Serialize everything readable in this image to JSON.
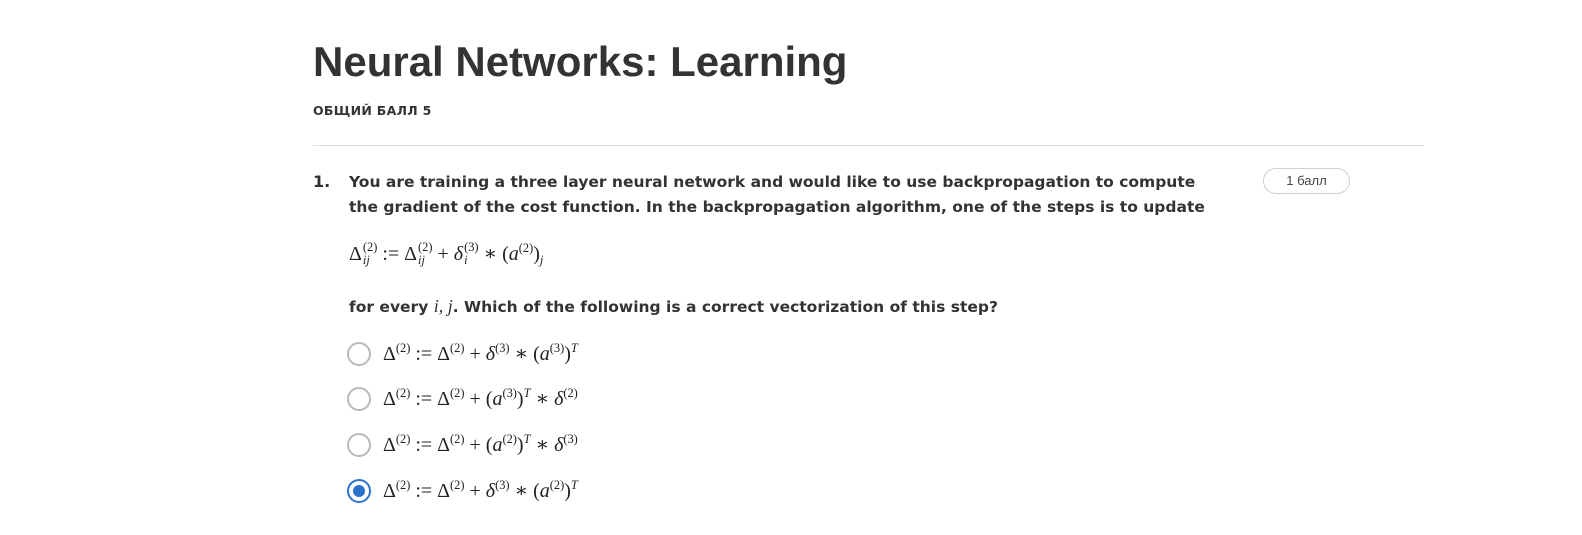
{
  "page": {
    "title": "Neural Networks: Learning",
    "score_label": "ОБЩИЙ БАЛЛ 5"
  },
  "question": {
    "number": "1.",
    "points_label": "1 балл",
    "text": "You are training a three layer neural network and would like to use backpropagation to compute the gradient of the cost function. In the backpropagation algorithm, one of the steps is to update",
    "update_formula": "Δ_{ij}^{(2)} := Δ_{ij}^{(2)} + δ_i^{(3)} ∗ (a^{(2)})_j",
    "follow_prefix": "for every ",
    "follow_math": "i, j",
    "follow_suffix": ". Which of the following is a correct vectorization of this step?",
    "options": [
      {
        "formula": "Δ^{(2)} := Δ^{(2)} + δ^{(3)} ∗ (a^{(3)})^T",
        "selected": false
      },
      {
        "formula": "Δ^{(2)} := Δ^{(2)} + (a^{(3)})^T ∗ δ^{(2)}",
        "selected": false
      },
      {
        "formula": "Δ^{(2)} := Δ^{(2)} + (a^{(2)})^T ∗ δ^{(3)}",
        "selected": false
      },
      {
        "formula": "Δ^{(2)} := Δ^{(2)} + δ^{(3)} ∗ (a^{(2)})^T",
        "selected": true
      }
    ]
  },
  "colors": {
    "accent": "#2a73cc",
    "text": "#333333",
    "divider": "#dcdcdc",
    "radio_border": "#b9b9b9"
  }
}
